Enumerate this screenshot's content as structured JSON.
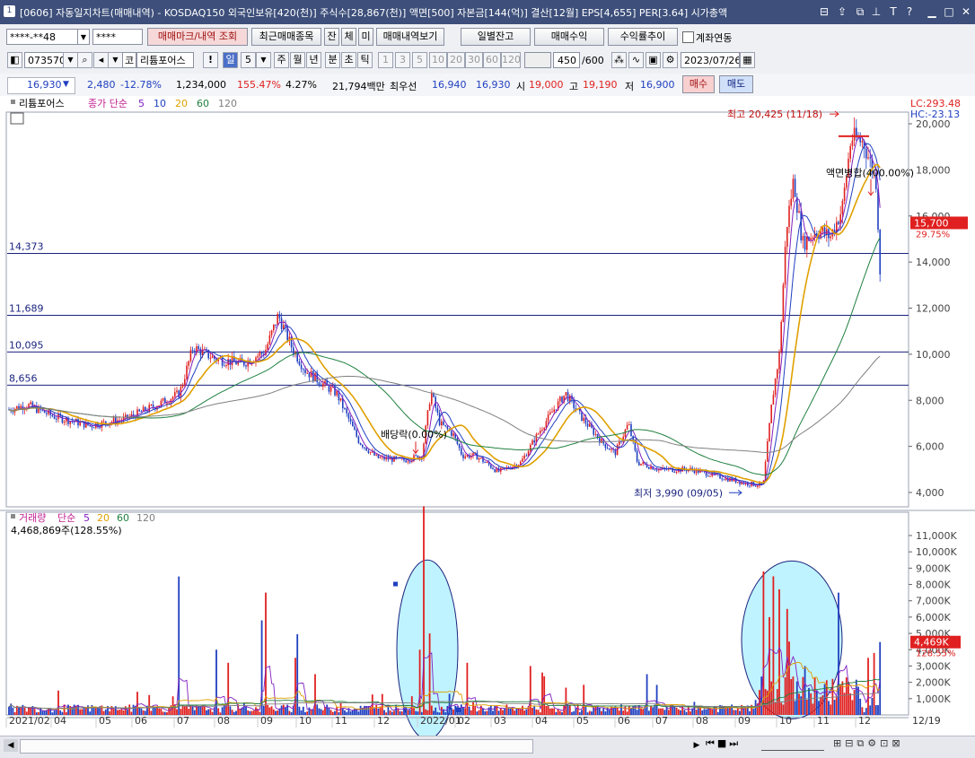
{
  "window": {
    "app_icon": "1",
    "title": "[0606] 자동일지차트(매매내역) - KOSDAQ150 외국인보유[420(천)] 주식수[28,867(천)] 액면[500] 자본금[144(억)] 결산[12월] EPS[4,655] PER[3.64] 시가총액"
  },
  "toolbar1": {
    "account": "****-**48",
    "password": "****",
    "buttons": [
      "매매마크/내역 조회",
      "최근매매종목",
      "잔",
      "체",
      "미",
      "매매내역보기",
      "일별잔고",
      "매매수익",
      "수익률추이"
    ],
    "link_label": "계좌연동"
  },
  "toolbar2": {
    "code": "073570",
    "market": "코",
    "name": "리튬포어스",
    "excl": "!",
    "period_selected": "일",
    "period_num": "5",
    "periods": [
      "주",
      "월",
      "년",
      "분",
      "초",
      "틱"
    ],
    "nums": [
      "1",
      "3",
      "5",
      "10",
      "20",
      "30",
      "60",
      "120"
    ],
    "count": "450",
    "max": "/600",
    "date": "2023/07/26"
  },
  "quote": {
    "price": "16,930",
    "arrow": "▼",
    "change": "2,480",
    "change_pct": "-12.78%",
    "volume": "1,234,000",
    "volume_ratio": "155.47%",
    "turnover": "4.27%",
    "amount": "21,794백만",
    "best_ask_label": "최우선",
    "best_ask": "16,940",
    "best_bid": "16,930",
    "open_label": "시",
    "open": "19,000",
    "high_label": "고",
    "high": "19,190",
    "low_label": "저",
    "low": "16,900",
    "buy": "매수",
    "sell": "매도"
  },
  "price_panel": {
    "legend": {
      "name": "리튬포어스",
      "ma_label": "종가 단순",
      "ma": [
        {
          "p": "5",
          "color": "#8020c0"
        },
        {
          "p": "10",
          "color": "#2040c0"
        },
        {
          "p": "20",
          "color": "#e0a000"
        },
        {
          "p": "60",
          "color": "#208040"
        },
        {
          "p": "120",
          "color": "#808080"
        }
      ]
    },
    "lc": "LC:293.48",
    "hc": "HC:-23.13",
    "current_price": "15,700",
    "current_pct": "29.75%",
    "hlines": [
      {
        "label": "14,373",
        "value": 14373
      },
      {
        "label": "11,689",
        "value": 11689
      },
      {
        "label": "10,095",
        "value": 10095
      },
      {
        "label": "8,656",
        "value": 8656
      }
    ],
    "annotations": {
      "high": "최고 20,425 (11/18)",
      "low": "최저 3,990 (09/05)",
      "dividend": "배당락(0.00%)",
      "split": "액면병합(400.00%)"
    },
    "y_ticks": [
      "20,000",
      "18,000",
      "16,000",
      "14,000",
      "12,000",
      "10,000",
      "8,000",
      "6,000",
      "4,000"
    ]
  },
  "volume_panel": {
    "legend": {
      "name": "거래량",
      "ma_label": "단순",
      "ma": [
        "5",
        "20",
        "60",
        "120"
      ]
    },
    "current": "4,468,869주(128.55%)",
    "right_value": "4,469K",
    "right_pct": "128.55%",
    "y_ticks": [
      "11,000K",
      "10,000K",
      "9,000K",
      "8,000K",
      "7,000K",
      "6,000K",
      "5,000K",
      "4,000K",
      "3,000K",
      "2,000K",
      "1,000K"
    ]
  },
  "x_axis": [
    "2021/02",
    "04",
    "05",
    "06",
    "07",
    "08",
    "09",
    "10",
    "11",
    "12",
    "2022/01",
    "02",
    "03",
    "04",
    "05",
    "06",
    "07",
    "08",
    "09",
    "10",
    "11",
    "12",
    "12/19"
  ],
  "colors": {
    "up": "#e02020",
    "down": "#2040c0",
    "title_bg": "#3d4f7a",
    "hline": "#1a237e",
    "highlight": "#bff3ff"
  }
}
